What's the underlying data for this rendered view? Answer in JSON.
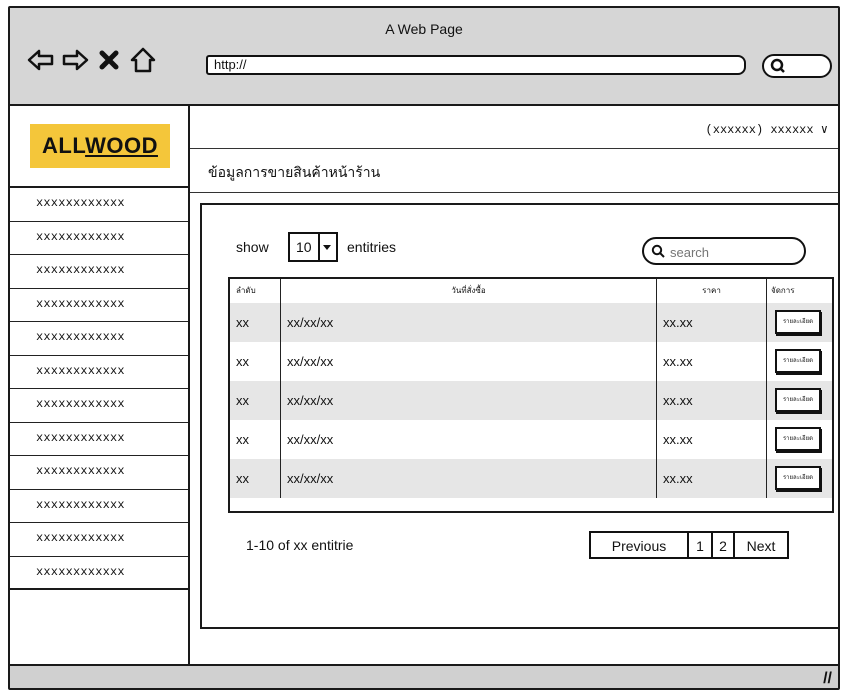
{
  "window": {
    "title": "A Web Page"
  },
  "browser": {
    "url": "http://",
    "nav_icons": [
      "back-arrow-icon",
      "forward-arrow-icon",
      "close-x-icon",
      "home-icon"
    ],
    "search_icon": "search-icon"
  },
  "brand": {
    "logo_text_prefix": "ALL",
    "logo_text_suffix": "WOOD",
    "logo_color": "#f4c63a"
  },
  "header": {
    "user_menu": "(xxxxxx) xxxxxx ∨"
  },
  "page": {
    "heading": "ข้อมูลการขายสินค้าหน้าร้าน"
  },
  "sidebar": {
    "items": [
      "xxxxxxxxxxxx",
      "xxxxxxxxxxxx",
      "xxxxxxxxxxxx",
      "xxxxxxxxxxxx",
      "xxxxxxxxxxxx",
      "xxxxxxxxxxxx",
      "xxxxxxxxxxxx",
      "xxxxxxxxxxxx",
      "xxxxxxxxxxxx",
      "xxxxxxxxxxxx",
      "xxxxxxxxxxxx",
      "xxxxxxxxxxxx"
    ]
  },
  "controls": {
    "show_label": "show",
    "page_size": "10",
    "entries_label": "entitries",
    "search_placeholder": "search"
  },
  "table": {
    "headers": [
      "ลำดับ",
      "วันที่สั่งซื้อ",
      "ราคา",
      "จัดการ"
    ],
    "rows": [
      {
        "no": "xx",
        "date": "xx/xx/xx",
        "price": "xx.xx",
        "action": "รายละเอียด"
      },
      {
        "no": "xx",
        "date": "xx/xx/xx",
        "price": "xx.xx",
        "action": "รายละเอียด"
      },
      {
        "no": "xx",
        "date": "xx/xx/xx",
        "price": "xx.xx",
        "action": "รายละเอียด"
      },
      {
        "no": "xx",
        "date": "xx/xx/xx",
        "price": "xx.xx",
        "action": "รายละเอียด"
      },
      {
        "no": "xx",
        "date": "xx/xx/xx",
        "price": "xx.xx",
        "action": "รายละเอียด"
      }
    ]
  },
  "pagination": {
    "info": "1-10 of xx entitrie",
    "previous": "Previous",
    "page1": "1",
    "page2": "2",
    "next": "Next"
  },
  "status_bar": {
    "grip": "//"
  }
}
